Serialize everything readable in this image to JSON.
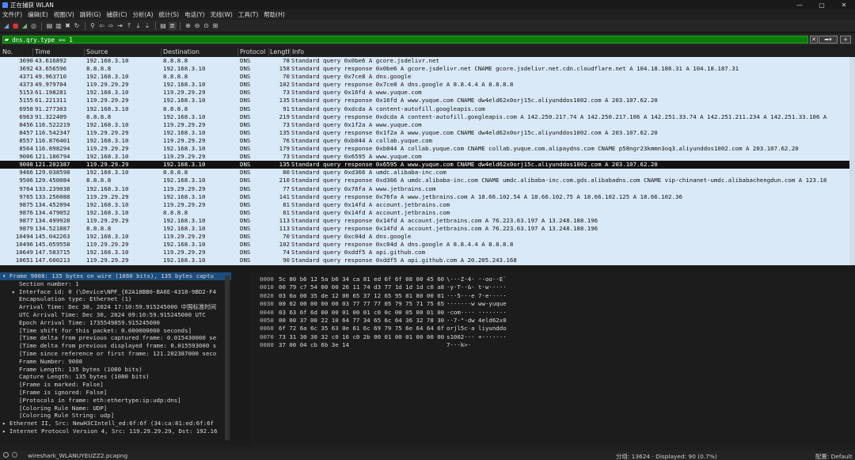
{
  "window": {
    "title": "正在捕获 WLAN"
  },
  "menu": [
    "文件(F)",
    "编辑(E)",
    "视图(V)",
    "跳转(G)",
    "捕获(C)",
    "分析(A)",
    "统计(S)",
    "电话(Y)",
    "无线(W)",
    "工具(T)",
    "帮助(H)"
  ],
  "filter": {
    "value": "dns.qry.type == 1"
  },
  "columns": [
    "No.",
    "Time",
    "Source",
    "Destination",
    "Protocol",
    "Length",
    "Info"
  ],
  "packets": [
    {
      "no": "3690",
      "time": "43.616892",
      "src": "192.168.3.10",
      "dst": "8.8.8.8",
      "proto": "DNS",
      "len": "78",
      "info": "Standard query 0x0be6 A gcore.jsdelivr.net"
    },
    {
      "no": "3692",
      "time": "43.656596",
      "src": "8.8.8.8",
      "dst": "192.168.3.10",
      "proto": "DNS",
      "len": "158",
      "info": "Standard query response 0x0be6 A gcore.jsdelivr.net CNAME gcore.jsdelivr.net.cdn.cloudflare.net A 104.18.186.31 A 104.18.187.31"
    },
    {
      "no": "4371",
      "time": "49.963710",
      "src": "192.168.3.10",
      "dst": "8.8.8.8",
      "proto": "DNS",
      "len": "70",
      "info": "Standard query 0x7ce8 A dns.google"
    },
    {
      "no": "4373",
      "time": "49.979704",
      "src": "119.29.29.29",
      "dst": "192.168.3.10",
      "proto": "DNS",
      "len": "102",
      "info": "Standard query response 0x7ce8 A dns.google A 8.8.4.4 A 8.8.8.8"
    },
    {
      "no": "5153",
      "time": "61.198281",
      "src": "192.168.3.10",
      "dst": "119.29.29.29",
      "proto": "DNS",
      "len": "73",
      "info": "Standard query 0x16fd A www.yuque.com"
    },
    {
      "no": "5155",
      "time": "61.221311",
      "src": "119.29.29.29",
      "dst": "192.168.3.10",
      "proto": "DNS",
      "len": "135",
      "info": "Standard query response 0x16fd A www.yuque.com CNAME dw4eld62x0orj15c.aliyunddos1002.com A 203.107.62.20"
    },
    {
      "no": "6958",
      "time": "91.277303",
      "src": "192.168.3.10",
      "dst": "8.8.8.8",
      "proto": "DNS",
      "len": "91",
      "info": "Standard query 0xdcda A content-autofill.googleapis.com"
    },
    {
      "no": "6963",
      "time": "91.322409",
      "src": "8.8.8.8",
      "dst": "192.168.3.10",
      "proto": "DNS",
      "len": "219",
      "info": "Standard query response 0xdcda A content-autofill.googleapis.com A 142.250.217.74 A 142.250.217.106 A 142.251.33.74 A 142.251.211.234 A 142.251.33.106 A"
    },
    {
      "no": "8456",
      "time": "116.522219",
      "src": "192.168.3.10",
      "dst": "119.29.29.29",
      "proto": "DNS",
      "len": "73",
      "info": "Standard query 0x1f2a A www.yuque.com"
    },
    {
      "no": "8457",
      "time": "116.542347",
      "src": "119.29.29.29",
      "dst": "192.168.3.10",
      "proto": "DNS",
      "len": "135",
      "info": "Standard query response 0x1f2a A www.yuque.com CNAME dw4eld62x0orj15c.aliyunddos1002.com A 203.107.62.20"
    },
    {
      "no": "8557",
      "time": "116.876401",
      "src": "192.168.3.10",
      "dst": "119.29.29.29",
      "proto": "DNS",
      "len": "76",
      "info": "Standard query 0xb044 A collab.yuque.com"
    },
    {
      "no": "8564",
      "time": "116.898294",
      "src": "119.29.29.29",
      "dst": "192.168.3.10",
      "proto": "DNS",
      "len": "179",
      "info": "Standard query response 0xb044 A collab.yuque.com CNAME collab.yuque.com.alipaydns.com CNAME p58ngr23kmmn3oq3.aliyunddos1002.com A 203.107.62.20"
    },
    {
      "no": "9006",
      "time": "121.186794",
      "src": "192.168.3.10",
      "dst": "119.29.29.29",
      "proto": "DNS",
      "len": "73",
      "info": "Standard query 0x6595 A www.yuque.com"
    },
    {
      "no": "9008",
      "time": "121.202387",
      "src": "119.29.29.29",
      "dst": "192.168.3.10",
      "proto": "DNS",
      "len": "135",
      "info": "Standard query response 0x6595 A www.yuque.com CNAME dw4eld62x0orj15c.aliyunddos1002.com A 203.107.62.20",
      "selected": true
    },
    {
      "no": "9466",
      "time": "129.038598",
      "src": "192.168.3.10",
      "dst": "8.8.8.8",
      "proto": "DNS",
      "len": "80",
      "info": "Standard query 0xd366 A umdc.alibaba-inc.com"
    },
    {
      "no": "9506",
      "time": "129.450084",
      "src": "8.8.8.8",
      "dst": "192.168.3.10",
      "proto": "DNS",
      "len": "210",
      "info": "Standard query response 0xd366 A umdc.alibaba-inc.com CNAME umdc.alibaba-inc.com.gds.alibabadns.com CNAME vip-chinanet-umdc.alibabachengdun.com A 123.18"
    },
    {
      "no": "9764",
      "time": "133.239038",
      "src": "192.168.3.10",
      "dst": "119.29.29.29",
      "proto": "DNS",
      "len": "77",
      "info": "Standard query 0x76fa A www.jetbrains.com"
    },
    {
      "no": "9765",
      "time": "133.256088",
      "src": "119.29.29.29",
      "dst": "192.168.3.10",
      "proto": "DNS",
      "len": "141",
      "info": "Standard query response 0x76fa A www.jetbrains.com A 18.66.102.54 A 18.66.102.75 A 18.66.102.125 A 18.66.102.36"
    },
    {
      "no": "9875",
      "time": "134.452094",
      "src": "192.168.3.10",
      "dst": "119.29.29.29",
      "proto": "DNS",
      "len": "81",
      "info": "Standard query 0x14fd A account.jetbrains.com"
    },
    {
      "no": "9876",
      "time": "134.479052",
      "src": "192.168.3.10",
      "dst": "8.8.8.8",
      "proto": "DNS",
      "len": "81",
      "info": "Standard query 0x14fd A account.jetbrains.com"
    },
    {
      "no": "9877",
      "time": "134.499928",
      "src": "119.29.29.29",
      "dst": "192.168.3.10",
      "proto": "DNS",
      "len": "113",
      "info": "Standard query response 0x14fd A account.jetbrains.com A 76.223.63.197 A 13.248.188.196"
    },
    {
      "no": "9879",
      "time": "134.521887",
      "src": "8.8.8.8",
      "dst": "192.168.3.10",
      "proto": "DNS",
      "len": "113",
      "info": "Standard query response 0x14fd A account.jetbrains.com A 76.223.63.197 A 13.248.188.196"
    },
    {
      "no": "10494",
      "time": "145.042263",
      "src": "192.168.3.10",
      "dst": "119.29.29.29",
      "proto": "DNS",
      "len": "70",
      "info": "Standard query 0xc04d A dns.google"
    },
    {
      "no": "10496",
      "time": "145.059558",
      "src": "119.29.29.29",
      "dst": "192.168.3.10",
      "proto": "DNS",
      "len": "102",
      "info": "Standard query response 0xc04d A dns.google A 8.8.4.4 A 8.8.8.8"
    },
    {
      "no": "10649",
      "time": "147.583715",
      "src": "192.168.3.10",
      "dst": "119.29.29.29",
      "proto": "DNS",
      "len": "74",
      "info": "Standard query 0xddf5 A api.github.com"
    },
    {
      "no": "10651",
      "time": "147.600213",
      "src": "119.29.29.29",
      "dst": "192.168.3.10",
      "proto": "DNS",
      "len": "90",
      "info": "Standard query response 0xddf5 A api.github.com A 20.205.243.168"
    }
  ],
  "details": [
    {
      "text": "Frame 9008: 135 bytes on wire (1080 bits), 135 bytes captu",
      "level": 0,
      "arrow": "▾",
      "selected": true
    },
    {
      "text": "Section number: 1",
      "level": 1
    },
    {
      "text": "Interface id: 0 (\\Device\\NPF_{62A18BB0-BA6E-4318-9BD2-F4",
      "level": 1,
      "arrow": "▸"
    },
    {
      "text": "Encapsulation type: Ethernet (1)",
      "level": 1
    },
    {
      "text": "Arrival Time: Dec 30, 2024 17:10:59.915245000 中国标准时间",
      "level": 1
    },
    {
      "text": "UTC Arrival Time: Dec 30, 2024 09:10:59.915245000 UTC",
      "level": 1
    },
    {
      "text": "Epoch Arrival Time: 1735549859.915245000",
      "level": 1
    },
    {
      "text": "[Time shift for this packet: 0.000000000 seconds]",
      "level": 1
    },
    {
      "text": "[Time delta from previous captured frame: 0.015430000 se",
      "level": 1
    },
    {
      "text": "[Time delta from previous displayed frame: 0.015593000 s",
      "level": 1
    },
    {
      "text": "[Time since reference or first frame: 121.202387000 seco",
      "level": 1
    },
    {
      "text": "Frame Number: 9008",
      "level": 1
    },
    {
      "text": "Frame Length: 135 bytes (1080 bits)",
      "level": 1
    },
    {
      "text": "Capture Length: 135 bytes (1080 bits)",
      "level": 1
    },
    {
      "text": "[Frame is marked: False]",
      "level": 1
    },
    {
      "text": "[Frame is ignored: False]",
      "level": 1
    },
    {
      "text": "[Protocols in frame: eth:ethertype:ip:udp:dns]",
      "level": 1
    },
    {
      "text": "[Coloring Rule Name: UDP]",
      "level": 1
    },
    {
      "text": "[Coloring Rule String: udp]",
      "level": 1
    },
    {
      "text": "Ethernet II, Src: NewH3CIntell_ed:6f:6f (34:ca:81:ed:6f:6f",
      "level": 0,
      "arrow": "▸"
    },
    {
      "text": "Internet Protocol Version 4, Src: 119.29.29.29, Dst: 192.16",
      "level": 0,
      "arrow": "▸"
    }
  ],
  "hexdump": [
    {
      "off": "0000",
      "bytes": "5c 80 b6 12 5a b6 34 ca  81 ed 6f 6f 08 00 45 60",
      "ascii": "\\···Z·4· ··oo··E`"
    },
    {
      "off": "0010",
      "bytes": "00 79 c7 54 00 00 26 11  74 d3 77 1d 1d 1d c0 a8",
      "ascii": "·y·T··&· t·w·····"
    },
    {
      "off": "0020",
      "bytes": "03 0a 00 35 de 12 00 65  37 12 65 95 81 80 00 01",
      "ascii": "···5···e 7·e·····"
    },
    {
      "off": "0030",
      "bytes": "00 02 00 00 00 00 03 77  77 77 05 79 75 71 75 65",
      "ascii": "·······w ww·yuque"
    },
    {
      "off": "0040",
      "bytes": "03 63 6f 6d 00 00 01 00  01 c0 0c 00 05 00 01 00",
      "ascii": "·com···· ········"
    },
    {
      "off": "0050",
      "bytes": "00 00 37 00 22 10 64 77  34 65 6c 64 36 32 78 30",
      "ascii": "··7·\"·dw 4eld62x0"
    },
    {
      "off": "0060",
      "bytes": "6f 72 6a 6c 35 63 0e 61  6c 69 79 75 6e 64 64 6f",
      "ascii": "orjl5c·a liyunddo"
    },
    {
      "off": "0070",
      "bytes": "73 31 30 30 32 c0 16 c0  2b 00 01 00 01 00 00 00",
      "ascii": "s1002··· +·······"
    },
    {
      "off": "0080",
      "bytes": "37 00 04 cb 6b 3e 14",
      "ascii": "7···k>·"
    }
  ],
  "status": {
    "file": "wireshark_WLANUYEUZZ2.pcapng",
    "counts": "分组: 13624 · Displayed: 90 (0.7%)",
    "profile": "配置: Default"
  },
  "colors": {
    "row_bg": "#dae9f7",
    "selected_bg": "#121212",
    "filter_ok": "#0b7a0b"
  }
}
